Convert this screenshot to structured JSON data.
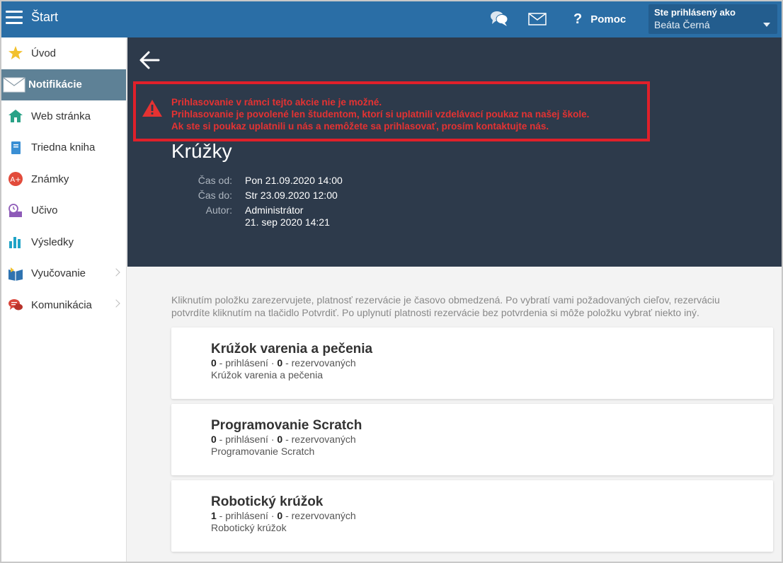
{
  "topbar": {
    "menu_icon": "hamburger-menu-icon",
    "title": "Štart",
    "chat_icon": "chat-bubbles-icon",
    "mail_icon": "envelope-icon",
    "help_glyph": "?",
    "help_label": "Pomoc",
    "user_caption": "Ste prihlásený ako",
    "user_name": "Beáta Černá"
  },
  "sidebar": {
    "items": [
      {
        "label": "Úvod",
        "icon": "star-icon"
      },
      {
        "label": "Notifikácie",
        "icon": "envelope-icon",
        "active": true
      },
      {
        "label": "Web stránka",
        "icon": "house-icon"
      },
      {
        "label": "Triedna kniha",
        "icon": "book-icon"
      },
      {
        "label": "Známky",
        "icon": "grade-icon"
      },
      {
        "label": "Učivo",
        "icon": "clock-board-icon"
      },
      {
        "label": "Výsledky",
        "icon": "bar-chart-icon"
      },
      {
        "label": "Vyučovanie",
        "icon": "open-book-icon",
        "has_submenu": true
      },
      {
        "label": "Komunikácia",
        "icon": "speech-bubbles-icon",
        "has_submenu": true
      }
    ]
  },
  "alert": {
    "lines": [
      "Prihlasovanie v rámci tejto akcie nie je možné.",
      "Prihlasovanie je povolené len študentom, ktorí si uplatnili vzdelávací poukaz na našej škole.",
      "Ak ste si poukaz uplatnili u nás a nemôžete sa prihlasovať, prosím kontaktujte nás."
    ],
    "color": "#e0202a"
  },
  "event": {
    "title": "Krúžky",
    "from_label": "Čas od:",
    "from_value": "Pon 21.09.2020 14:00",
    "to_label": "Čas do:",
    "to_value": "Str 23.09.2020 12:00",
    "author_label": "Autor:",
    "author_name": "Administrátor",
    "author_date": "21. sep 2020 14:21"
  },
  "intro_text": "Kliknutím položku zarezervujete, platnosť rezervácie je časovo obmedzená. Po vybratí vami požadovaných cieľov, rezerváciu potvrdíte kliknutím na tlačidlo Potvrdiť. Po uplynutí platnosti rezervácie bez potvrdenia si môže položku vybrať niekto iný.",
  "cards": [
    {
      "title": "Krúžok varenia a pečenia",
      "signed": "0",
      "signed_label": " - prihlásení · ",
      "reserved": "0",
      "reserved_label": " - rezervovaných",
      "desc": "Krúžok varenia a pečenia"
    },
    {
      "title": "Programovanie Scratch",
      "signed": "0",
      "signed_label": " - prihlásení · ",
      "reserved": "0",
      "reserved_label": " - rezervovaných",
      "desc": "Programovanie Scratch"
    },
    {
      "title": "Robotický krúžok",
      "signed": "1",
      "signed_label": " - prihlásení · ",
      "reserved": "0",
      "reserved_label": " - rezervovaných",
      "desc": "Robotický krúžok"
    }
  ],
  "colors": {
    "topbar": "#2a6ea6",
    "hero": "#2d3a4b",
    "active_nav": "#5e8196"
  }
}
